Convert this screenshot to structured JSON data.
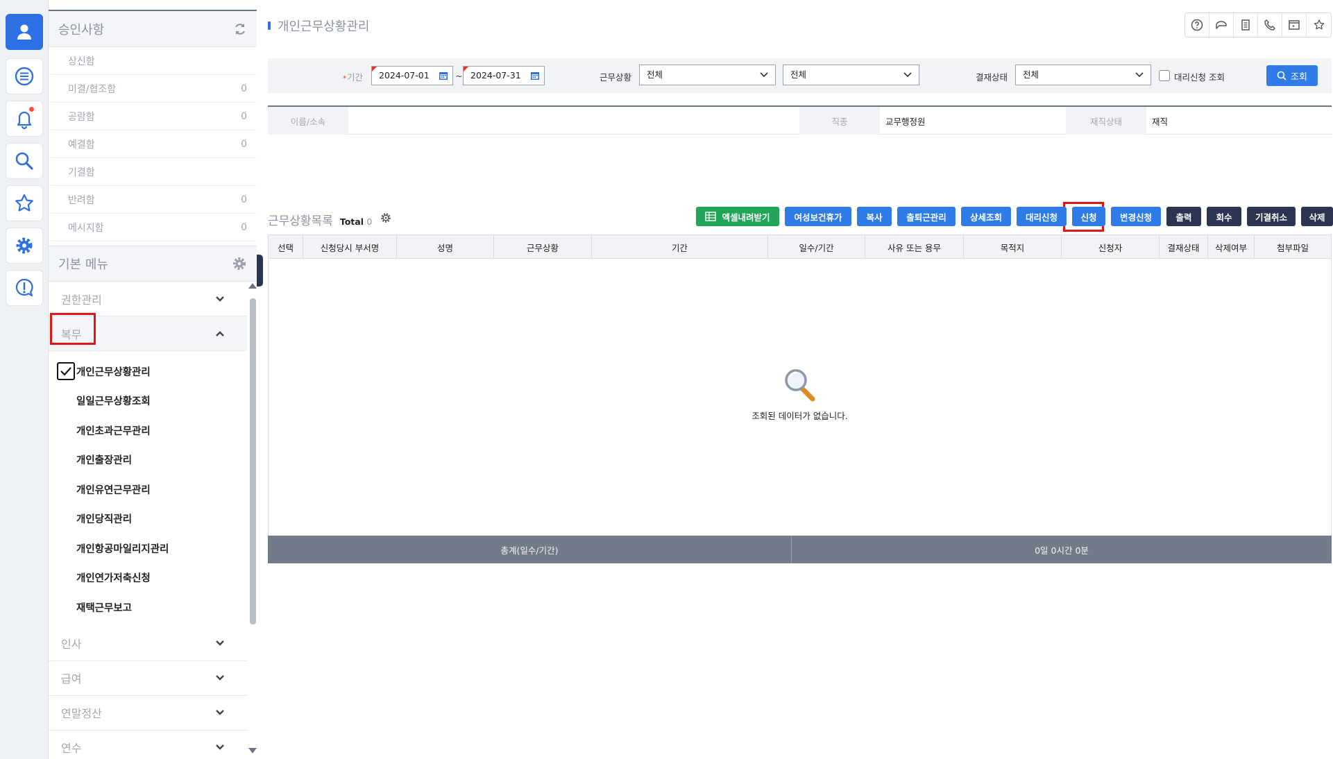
{
  "rail": {
    "icons": [
      "user-icon",
      "list-icon",
      "bell-icon",
      "search-icon",
      "star-icon",
      "gear-icon",
      "help-chat-icon"
    ]
  },
  "sidebar": {
    "approval_title": "승인사항",
    "approval_items": [
      {
        "label": "상신함",
        "count": ""
      },
      {
        "label": "미결/협조함",
        "count": "0"
      },
      {
        "label": "공람함",
        "count": "0"
      },
      {
        "label": "예결함",
        "count": "0"
      },
      {
        "label": "기결함",
        "count": ""
      },
      {
        "label": "반려함",
        "count": "0"
      },
      {
        "label": "메시지함",
        "count": "0"
      }
    ],
    "menu_title": "기본 메뉴",
    "groups_top": [
      {
        "label": "권한관리"
      },
      {
        "label": "복무"
      }
    ],
    "sub_items": [
      {
        "label": "개인근무상황관리"
      },
      {
        "label": "일일근무상황조회"
      },
      {
        "label": "개인초과근무관리"
      },
      {
        "label": "개인출장관리"
      },
      {
        "label": "개인유연근무관리"
      },
      {
        "label": "개인당직관리"
      },
      {
        "label": "개인항공마일리지관리"
      },
      {
        "label": "개인연가저축신청"
      },
      {
        "label": "재택근무보고"
      }
    ],
    "groups_bottom": [
      {
        "label": "인사"
      },
      {
        "label": "급여"
      },
      {
        "label": "연말정산"
      },
      {
        "label": "연수"
      }
    ]
  },
  "page": {
    "title": "개인근무상황관리"
  },
  "filter": {
    "period_label": "기간",
    "date_from": "2024-07-01",
    "separator": "~",
    "date_to": "2024-07-31",
    "work_status_label": "근무상황",
    "work_status_value": "전체",
    "work_status_value2": "전체",
    "approval_status_label": "결재상태",
    "approval_status_value": "전체",
    "proxy_label": "대리신청 조회",
    "search_label": "조회"
  },
  "info": {
    "name_label": "이름/소속",
    "name_value": "",
    "position_label": "직종",
    "position_value": "교무행정원",
    "status_label": "재직상태",
    "status_value": "재직"
  },
  "list": {
    "title": "근무상황목록",
    "total_label": "Total",
    "total_count": "0",
    "buttons": {
      "excel": "엑셀내려받기",
      "female_leave": "여성보건휴가",
      "copy": "복사",
      "commute": "출퇴근관리",
      "detail": "상세조회",
      "proxy": "대리신청",
      "apply": "신청",
      "change": "변경신청",
      "print": "출력",
      "recall": "회수",
      "cancel": "기결취소",
      "delete": "삭제"
    },
    "columns": [
      "선택",
      "신청당시 부서명",
      "성명",
      "근무상황",
      "기간",
      "일수/기간",
      "사유 또는 용무",
      "목적지",
      "신청자",
      "결재상태",
      "삭제여부",
      "첨부파일"
    ],
    "empty_message": "조회된 데이터가 없습니다.",
    "footer_label": "총계(일수/기간)",
    "footer_value": "0일 0시간 0분"
  }
}
